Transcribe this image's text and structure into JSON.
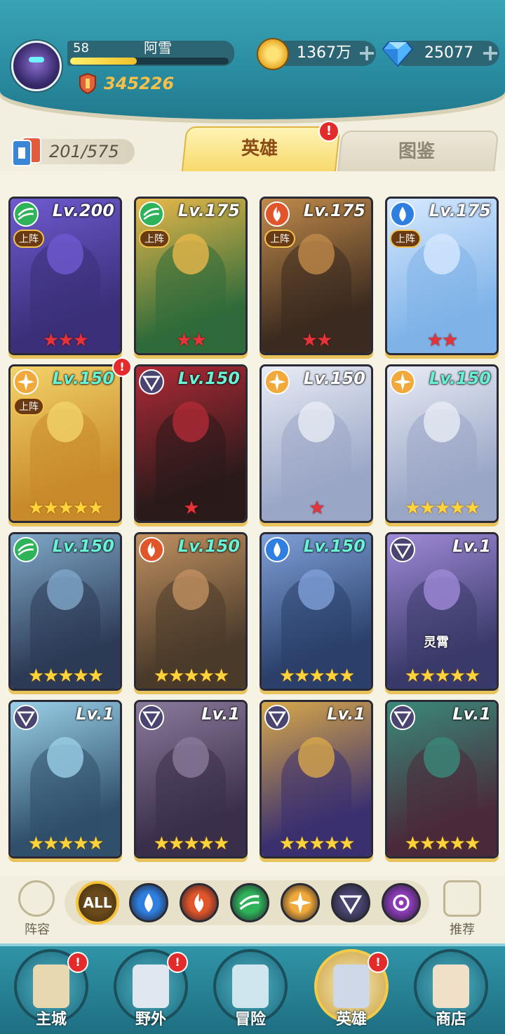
{
  "player": {
    "level": "58",
    "name": "阿雪",
    "xp_fraction": 0.42,
    "power": "345226"
  },
  "currency": {
    "gold": "1367万",
    "gems": "25077",
    "plus": "+"
  },
  "collection": {
    "count": "201/575"
  },
  "tabs": {
    "heroes": "英雄",
    "codex": "图鉴",
    "alert": "!"
  },
  "hero_cards": [
    {
      "level": "Lv.200",
      "element": "wind",
      "lineup": "上阵",
      "stars": "★★★",
      "star_color": "red",
      "alert": "",
      "name": "",
      "level_color": "#ffffff"
    },
    {
      "level": "Lv.175",
      "element": "wind",
      "lineup": "上阵",
      "stars": "★★",
      "star_color": "red",
      "alert": "",
      "name": "",
      "level_color": "#ffffff"
    },
    {
      "level": "Lv.175",
      "element": "fire",
      "lineup": "上阵",
      "stars": "★★",
      "star_color": "red",
      "alert": "",
      "name": "",
      "level_color": "#ffffff"
    },
    {
      "level": "Lv.175",
      "element": "water",
      "lineup": "上阵",
      "stars": "★★",
      "star_color": "red",
      "alert": "",
      "name": "",
      "level_color": "#ffffff"
    },
    {
      "level": "Lv.150",
      "element": "light",
      "lineup": "上阵",
      "stars": "★★★★★",
      "star_color": "gold",
      "alert": "!",
      "name": "",
      "level_color": "#67f2d6"
    },
    {
      "level": "Lv.150",
      "element": "dark",
      "lineup": "",
      "stars": "★",
      "star_color": "red",
      "alert": "",
      "name": "",
      "level_color": "#67f2d6"
    },
    {
      "level": "Lv.150",
      "element": "light",
      "lineup": "",
      "stars": "★",
      "star_color": "red",
      "alert": "",
      "name": "",
      "level_color": "#ffffff"
    },
    {
      "level": "Lv.150",
      "element": "light",
      "lineup": "",
      "stars": "★★★★★",
      "star_color": "gold",
      "alert": "",
      "name": "",
      "level_color": "#67f2d6"
    },
    {
      "level": "Lv.150",
      "element": "wind",
      "lineup": "",
      "stars": "★★★★★",
      "star_color": "gold",
      "alert": "",
      "name": "",
      "level_color": "#67f2d6"
    },
    {
      "level": "Lv.150",
      "element": "fire",
      "lineup": "",
      "stars": "★★★★★",
      "star_color": "gold",
      "alert": "",
      "name": "",
      "level_color": "#67f2d6"
    },
    {
      "level": "Lv.150",
      "element": "water",
      "lineup": "",
      "stars": "★★★★★",
      "star_color": "gold",
      "alert": "",
      "name": "",
      "level_color": "#67f2d6"
    },
    {
      "level": "Lv.1",
      "element": "dark",
      "lineup": "",
      "stars": "★★★★★",
      "star_color": "gold",
      "alert": "",
      "name": "灵霄",
      "level_color": "#ffffff"
    },
    {
      "level": "Lv.1",
      "element": "dark",
      "lineup": "",
      "stars": "★★★★★",
      "star_color": "gold",
      "alert": "",
      "name": "",
      "level_color": "#ffffff"
    },
    {
      "level": "Lv.1",
      "element": "dark",
      "lineup": "",
      "stars": "★★★★★",
      "star_color": "gold",
      "alert": "",
      "name": "",
      "level_color": "#ffffff"
    },
    {
      "level": "Lv.1",
      "element": "dark",
      "lineup": "",
      "stars": "★★★★★",
      "star_color": "gold",
      "alert": "",
      "name": "",
      "level_color": "#ffffff"
    },
    {
      "level": "Lv.1",
      "element": "dark",
      "lineup": "",
      "stars": "★★★★★",
      "star_color": "gold",
      "alert": "",
      "name": "",
      "level_color": "#ffffff"
    }
  ],
  "filters": {
    "lineup_label": "阵容",
    "all_label": "ALL",
    "recommend_label": "推荐",
    "elements": [
      "water",
      "fire",
      "wind",
      "light",
      "dark",
      "chaos"
    ]
  },
  "element_colors": {
    "wind": "#2fb35a",
    "fire": "#e0552a",
    "water": "#2f7fe0",
    "light": "#f0a93a",
    "dark": "#4a4470",
    "chaos": "#8b3bb5"
  },
  "nav": {
    "items": [
      {
        "label": "主城",
        "alert": "!"
      },
      {
        "label": "野外",
        "alert": "!"
      },
      {
        "label": "冒险",
        "alert": ""
      },
      {
        "label": "英雄",
        "alert": "!"
      },
      {
        "label": "商店",
        "alert": ""
      }
    ]
  }
}
